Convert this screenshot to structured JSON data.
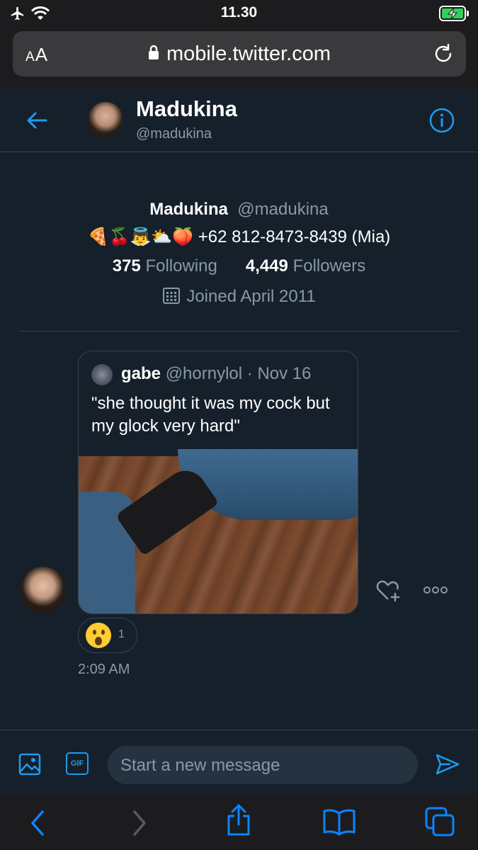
{
  "status_bar": {
    "time": "11.30"
  },
  "browser": {
    "text_size_label_big": "A",
    "text_size_label_small": "A",
    "url": "mobile.twitter.com"
  },
  "header": {
    "name": "Madukina",
    "handle": "@madukina"
  },
  "profile": {
    "name": "Madukina",
    "handle": "@madukina",
    "bio": "🍕🍒👼⛅🍑 +62 812-8473-8439 (Mia)",
    "following_count": "375",
    "following_label": "Following",
    "followers_count": "4,449",
    "followers_label": "Followers",
    "joined": "Joined April 2011"
  },
  "message": {
    "quoted_tweet": {
      "author_name": "gabe",
      "author_handle": "@hornylol",
      "separator": "·",
      "date": "Nov 16",
      "text": "\"she thought it was my cock but my glock very hard\""
    },
    "reaction": {
      "emoji": "astonished-face",
      "count": "1"
    },
    "time": "2:09 AM"
  },
  "composer": {
    "gif_label": "GIF",
    "placeholder": "Start a new message"
  },
  "colors": {
    "accent": "#1d9bf0",
    "background": "#15202b",
    "secondary_text": "#8899a6",
    "border": "#38444d"
  }
}
